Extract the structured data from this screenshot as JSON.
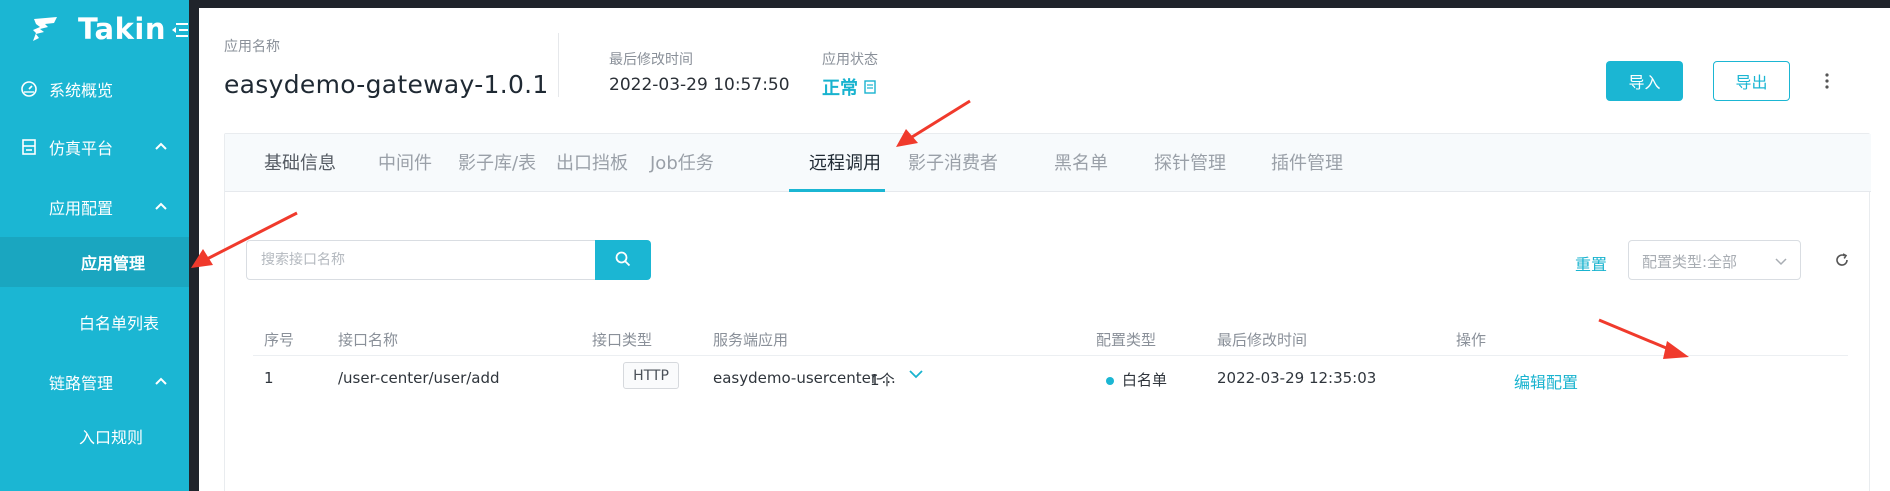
{
  "brand": {
    "name": "Takin"
  },
  "sidebar": {
    "items": [
      {
        "label": "系统概览",
        "icon": "dashboard-icon"
      },
      {
        "label": "仿真平台",
        "icon": "platform-icon"
      },
      {
        "label": "应用配置"
      },
      {
        "label": "应用管理"
      },
      {
        "label": "白名单列表"
      },
      {
        "label": "链路管理"
      },
      {
        "label": "入口规则"
      }
    ]
  },
  "header": {
    "app_name_label": "应用名称",
    "app_name": "easydemo-gateway-1.0.1",
    "modified_label": "最后修改时间",
    "modified_value": "2022-03-29 10:57:50",
    "status_label": "应用状态",
    "status_value": "正常",
    "import_label": "导入",
    "export_label": "导出"
  },
  "tabs": [
    {
      "label": "基础信息"
    },
    {
      "label": "中间件"
    },
    {
      "label": "影子库/表"
    },
    {
      "label": "出口挡板"
    },
    {
      "label": "Job任务"
    },
    {
      "label": "远程调用"
    },
    {
      "label": "影子消费者"
    },
    {
      "label": "黑名单"
    },
    {
      "label": "探针管理"
    },
    {
      "label": "插件管理"
    }
  ],
  "active_tab": "远程调用",
  "toolbar": {
    "search_placeholder": "搜索接口名称",
    "reset_label": "重置",
    "type_filter": "配置类型:全部"
  },
  "table": {
    "headers": [
      "序号",
      "接口名称",
      "接口类型",
      "服务端应用",
      "配置类型",
      "最后修改时间",
      "操作"
    ],
    "rows": [
      {
        "index": "1",
        "api_name": "/user-center/user/add",
        "api_type": "HTTP",
        "server_app": "easydemo-usercenter-...",
        "server_count": "1个",
        "config_type": "白名单",
        "modified": "2022-03-29 12:35:03",
        "action": "编辑配置"
      }
    ]
  },
  "colors": {
    "accent": "#1bb6d3",
    "sidebar_bg": "#1bb6d3",
    "annotation_arrow": "#f03a2c"
  }
}
